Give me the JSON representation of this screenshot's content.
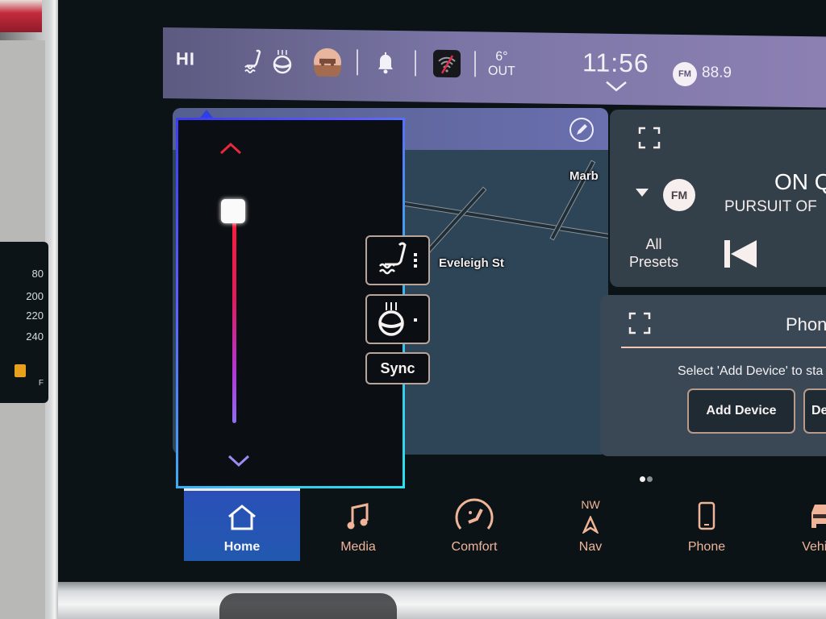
{
  "status_bar": {
    "greeting": "HI",
    "icons": [
      "heated-seat-icon",
      "heated-steering-wheel-icon",
      "vehicle-offroad-icon",
      "notification-bell-icon",
      "wifi-disabled-icon"
    ],
    "outside_temp": "6°",
    "outside_label": "OUT",
    "time": "11:56",
    "radio_band": "FM",
    "radio_frequency": "88.9"
  },
  "heat_popup": {
    "level_fraction": 0.9,
    "buttons": [
      {
        "name": "heated-seat",
        "level_dots": 3
      },
      {
        "name": "heated-steering-wheel",
        "level_dots": 1
      }
    ],
    "sync_label": "Sync"
  },
  "map": {
    "labels": [
      "Marb",
      "Eveleigh St"
    ]
  },
  "radio_widget": {
    "band": "FM",
    "station_title": "ON Q",
    "station_subtitle": "PURSUIT OF",
    "presets_label_1": "All",
    "presets_label_2": "Presets"
  },
  "phone_widget": {
    "title": "Phon",
    "message": "Select 'Add Device' to sta",
    "add_device_label": "Add Device",
    "second_button_label": "De"
  },
  "pager": {
    "pages": 2,
    "current": 1
  },
  "bottom_nav": {
    "items": [
      {
        "label": "Home",
        "active": true
      },
      {
        "label": "Media"
      },
      {
        "label": "Comfort"
      },
      {
        "label": "Nav",
        "heading": "NW"
      },
      {
        "label": "Phone"
      },
      {
        "label": "Vehicle"
      }
    ]
  },
  "cluster": {
    "speed_ticks": [
      "80",
      "200",
      "220",
      "240"
    ],
    "fuel_marker": "F"
  },
  "colors": {
    "status_bar": "#7b76a6",
    "accent_nav": "#f0b599",
    "home_active": "#2a50b8",
    "popup_border": "#36c0ee",
    "slider_hot": "#ff1b3a"
  }
}
